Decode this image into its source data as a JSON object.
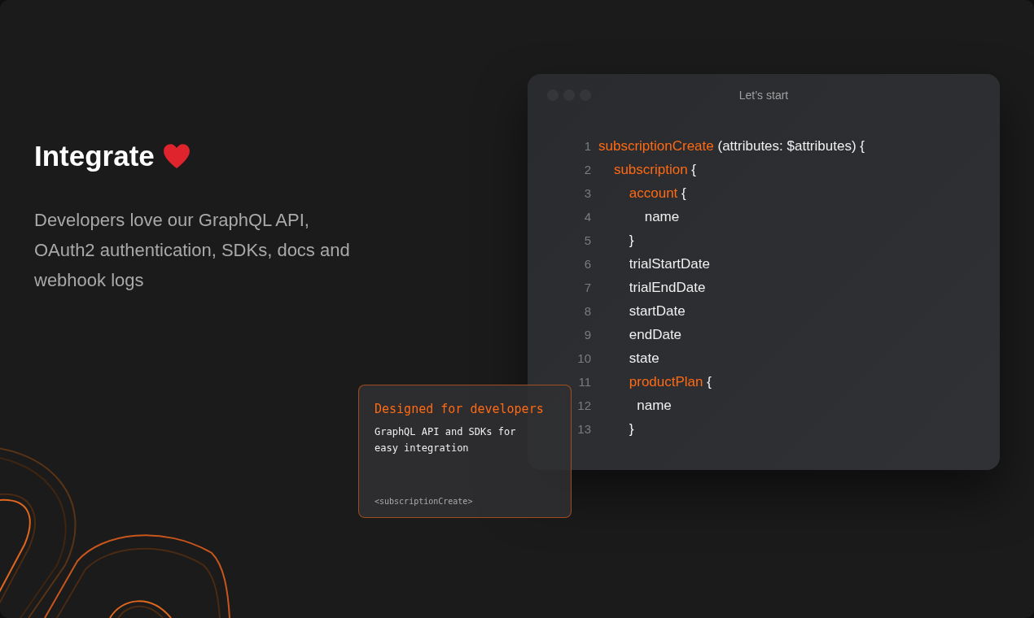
{
  "intro": {
    "title": "Integrate",
    "description": "Developers love our GraphQL API, OAuth2 authentication, SDKs, docs and webhook logs"
  },
  "code_window": {
    "title": "Let’s start",
    "lines": [
      {
        "number": "1",
        "tokens": [
          {
            "kind": "keyword",
            "text": "subscriptionCreate"
          },
          {
            "kind": "plain",
            "text": " (attributes: $attributes) {"
          }
        ]
      },
      {
        "number": "2",
        "tokens": [
          {
            "kind": "keyword",
            "text": "    subscription"
          },
          {
            "kind": "plain",
            "text": " {"
          }
        ]
      },
      {
        "number": "3",
        "tokens": [
          {
            "kind": "keyword",
            "text": "        account"
          },
          {
            "kind": "plain",
            "text": " {"
          }
        ]
      },
      {
        "number": "4",
        "tokens": [
          {
            "kind": "plain",
            "text": "            name"
          }
        ]
      },
      {
        "number": "5",
        "tokens": [
          {
            "kind": "plain",
            "text": "        }"
          }
        ]
      },
      {
        "number": "6",
        "tokens": [
          {
            "kind": "plain",
            "text": "        trialStartDate"
          }
        ]
      },
      {
        "number": "7",
        "tokens": [
          {
            "kind": "plain",
            "text": "        trialEndDate"
          }
        ]
      },
      {
        "number": "8",
        "tokens": [
          {
            "kind": "plain",
            "text": "        startDate"
          }
        ]
      },
      {
        "number": "9",
        "tokens": [
          {
            "kind": "plain",
            "text": "        endDate"
          }
        ]
      },
      {
        "number": "10",
        "tokens": [
          {
            "kind": "plain",
            "text": "        state"
          }
        ]
      },
      {
        "number": "11",
        "tokens": [
          {
            "kind": "keyword",
            "text": "        productPlan"
          },
          {
            "kind": "plain",
            "text": " {"
          }
        ]
      },
      {
        "number": "12",
        "tokens": [
          {
            "kind": "plain",
            "text": "          name"
          }
        ]
      },
      {
        "number": "13",
        "tokens": [
          {
            "kind": "plain",
            "text": "        }"
          }
        ]
      }
    ]
  },
  "feature_card": {
    "title": "Designed for developers",
    "body": "GraphQL API and SDKs for easy integration",
    "footer": "<subscriptionCreate>"
  }
}
